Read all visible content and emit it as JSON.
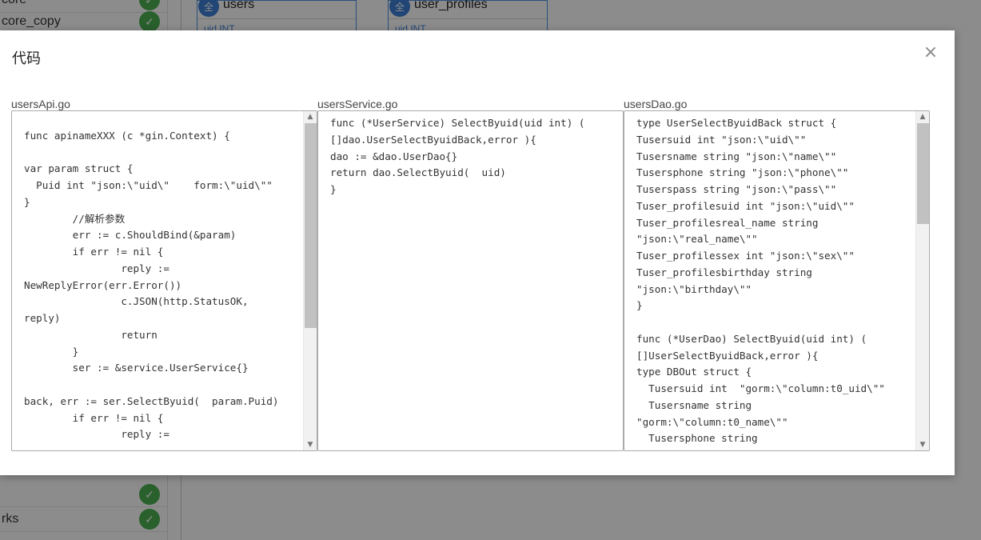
{
  "background": {
    "sidebar_items": [
      "core",
      "core_copy",
      "",
      "rks",
      ""
    ],
    "tables": [
      {
        "badge": "全",
        "name": "users",
        "row": "uid    INT"
      },
      {
        "badge": "全",
        "name": "user_profiles",
        "row": "uid    INT"
      }
    ]
  },
  "modal": {
    "title": "代码",
    "close_symbol": "×",
    "panels": [
      {
        "label": "usersApi.go",
        "lines": [
          "",
          "func apinameXXX (c *gin.Context) {",
          "",
          "var param struct {",
          "  Puid int \"json:\\\"uid\\\"    form:\\\"uid\\\"\"",
          "}",
          "        //解析参数",
          "        err := c.ShouldBind(&param)",
          "        if err != nil {",
          "                reply :=",
          "NewReplyError(err.Error())",
          "                c.JSON(http.StatusOK,",
          "reply)",
          "                return",
          "        }",
          "        ser := &service.UserService{}",
          "",
          "back, err := ser.SelectByuid(  param.Puid)",
          "        if err != nil {",
          "                reply :="
        ]
      },
      {
        "label": "usersService.go",
        "lines": [
          "func (*UserService) SelectByuid(uid int) (",
          "[]dao.UserSelectByuidBack,error ){",
          "dao := &dao.UserDao{}",
          "return dao.SelectByuid(  uid)",
          "}"
        ]
      },
      {
        "label": "usersDao.go",
        "lines": [
          "type UserSelectByuidBack struct {",
          "Tusersuid int \"json:\\\"uid\\\"\"",
          "Tusersname string \"json:\\\"name\\\"\"",
          "Tusersphone string \"json:\\\"phone\\\"\"",
          "Tuserspass string \"json:\\\"pass\\\"\"",
          "Tuser_profilesuid int \"json:\\\"uid\\\"\"",
          "Tuser_profilesreal_name string",
          "\"json:\\\"real_name\\\"\"",
          "Tuser_profilessex int \"json:\\\"sex\\\"\"",
          "Tuser_profilesbirthday string",
          "\"json:\\\"birthday\\\"\"",
          "}",
          "",
          "func (*UserDao) SelectByuid(uid int) (",
          "[]UserSelectByuidBack,error ){",
          "type DBOut struct {",
          "  Tusersuid int  \"gorm:\\\"column:t0_uid\\\"\"",
          "  Tusersname string",
          "\"gorm:\\\"column:t0_name\\\"\"",
          "  Tusersphone string"
        ]
      }
    ]
  },
  "colors": {
    "accent": "#3c7fd6",
    "success": "#4caf50"
  }
}
